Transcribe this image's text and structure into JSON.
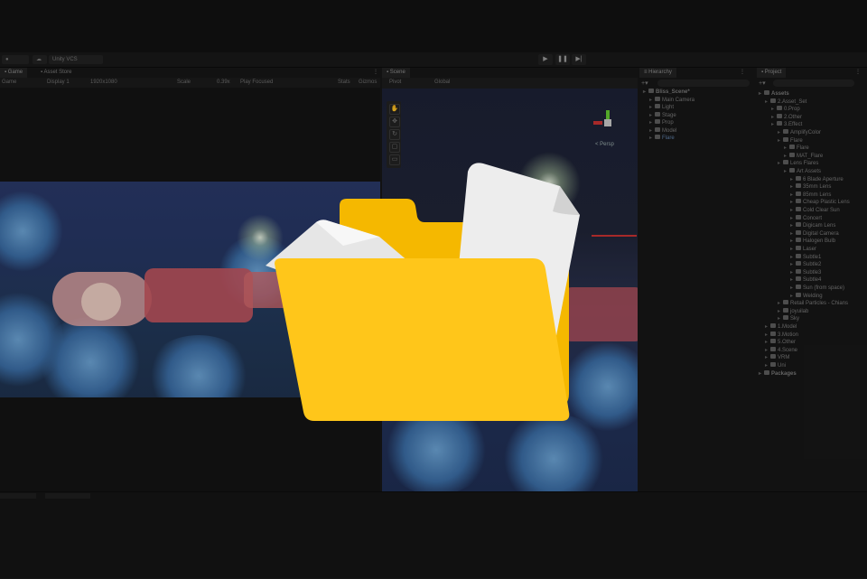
{
  "toolbar": {
    "account_label": "",
    "cloud_label": "Unity VCS",
    "play": "▶",
    "pause": "❚❚",
    "step": "▶|"
  },
  "game_tabs": [
    "Game",
    "Asset Store"
  ],
  "game_toolbar": {
    "view": "Game",
    "display": "Display 1",
    "resolution": "1920x1080",
    "scale_label": "Scale",
    "scale_value": "0.39x",
    "play_focused": "Play Focused",
    "stats": "Stats",
    "gizmos": "Gizmos"
  },
  "scene_tab": "Scene",
  "scene_toolbar": {
    "shading": "Pivot",
    "space": "Global",
    "persp_label": "< Persp"
  },
  "hierarchy": {
    "title": "Hierarchy",
    "items": [
      {
        "label": "Bliss_Scene*",
        "depth": 0,
        "bold": true
      },
      {
        "label": "Main Camera",
        "depth": 1
      },
      {
        "label": "Light",
        "depth": 1
      },
      {
        "label": "Stage",
        "depth": 1
      },
      {
        "label": "Prop",
        "depth": 1
      },
      {
        "label": "Model",
        "depth": 1
      },
      {
        "label": "Flare",
        "depth": 1,
        "selected": true
      }
    ]
  },
  "project": {
    "title": "Project",
    "items": [
      {
        "label": "Assets",
        "depth": 0,
        "bold": true
      },
      {
        "label": "2.Asset_Set",
        "depth": 1
      },
      {
        "label": "0.Prop",
        "depth": 2
      },
      {
        "label": "2.Other",
        "depth": 2
      },
      {
        "label": "3.Effect",
        "depth": 2
      },
      {
        "label": "AmplifyColor",
        "depth": 3
      },
      {
        "label": "Flare",
        "depth": 3
      },
      {
        "label": "Flare",
        "depth": 4
      },
      {
        "label": "MAT_Flare",
        "depth": 4
      },
      {
        "label": "Lens Flares",
        "depth": 3
      },
      {
        "label": "Art Assets",
        "depth": 4
      },
      {
        "label": "6 Blade Aperture",
        "depth": 5
      },
      {
        "label": "35mm Lens",
        "depth": 5
      },
      {
        "label": "85mm Lens",
        "depth": 5
      },
      {
        "label": "Cheap Plastic Lens",
        "depth": 5
      },
      {
        "label": "Cold Clear Sun",
        "depth": 5
      },
      {
        "label": "Concert",
        "depth": 5
      },
      {
        "label": "Digicam Lens",
        "depth": 5
      },
      {
        "label": "Digital Camera",
        "depth": 5
      },
      {
        "label": "Halogen Bulb",
        "depth": 5
      },
      {
        "label": "Laser",
        "depth": 5
      },
      {
        "label": "Subtle1",
        "depth": 5
      },
      {
        "label": "Subtle2",
        "depth": 5
      },
      {
        "label": "Subtle3",
        "depth": 5
      },
      {
        "label": "Subtle4",
        "depth": 5
      },
      {
        "label": "Sun (from space)",
        "depth": 5
      },
      {
        "label": "Welding",
        "depth": 5
      },
      {
        "label": "Retail Particles - Chians",
        "depth": 3
      },
      {
        "label": "joyuilab",
        "depth": 3
      },
      {
        "label": "Sky",
        "depth": 3
      },
      {
        "label": "1.Model",
        "depth": 1
      },
      {
        "label": "3.Motion",
        "depth": 1
      },
      {
        "label": "5.Other",
        "depth": 1
      },
      {
        "label": "4.Scene",
        "depth": 1
      },
      {
        "label": "VRM",
        "depth": 1
      },
      {
        "label": "Uni",
        "depth": 1
      },
      {
        "label": "Packages",
        "depth": 0,
        "bold": true
      }
    ]
  },
  "colors": {
    "folder_front": "#FFC61A",
    "folder_back": "#F5B800",
    "paper": "#F2F2F2",
    "selection": "#5f7fa8"
  },
  "overlay_icon": "open-folder-icon"
}
